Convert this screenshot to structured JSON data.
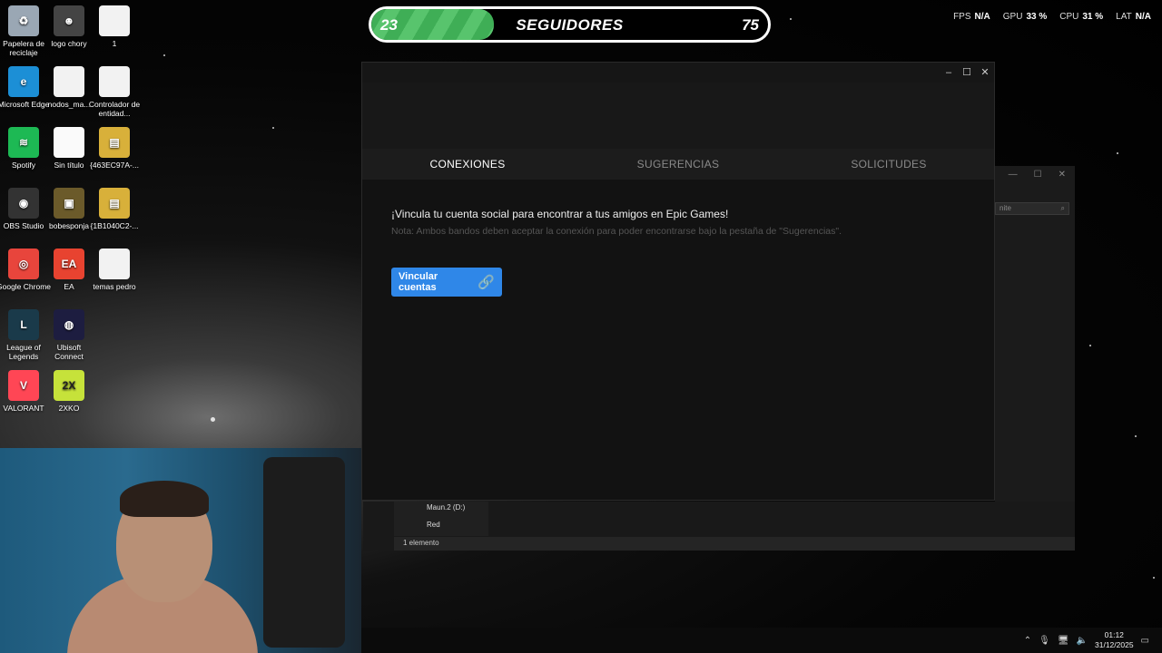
{
  "overlay": {
    "followers_current": "23",
    "followers_title": "SEGUIDORES",
    "followers_goal": "75",
    "followers_progress": 0.31,
    "stats": [
      {
        "label": "FPS",
        "value": "N/A"
      },
      {
        "label": "GPU",
        "value": "33 %"
      },
      {
        "label": "CPU",
        "value": "31 %"
      },
      {
        "label": "LAT",
        "value": "N/A"
      }
    ]
  },
  "desktop_icons": [
    {
      "label": "Papelera de reciclaje",
      "icon": "recycle-bin-icon",
      "color": "#9aa7b4",
      "glyph": "♻"
    },
    {
      "label": "logo chory",
      "icon": "image-file-icon",
      "color": "#444",
      "glyph": "☻"
    },
    {
      "label": "1",
      "icon": "file-icon",
      "color": "#f2f2f2",
      "glyph": ""
    },
    {
      "label": "Microsoft Edge",
      "icon": "edge-icon",
      "color": "#1c8fd6",
      "glyph": "e"
    },
    {
      "label": "nodos_ma...",
      "icon": "file-icon",
      "color": "#f2f2f2",
      "glyph": ""
    },
    {
      "label": "Controlador de entidad...",
      "icon": "file-icon",
      "color": "#f2f2f2",
      "glyph": ""
    },
    {
      "label": "Spotify",
      "icon": "spotify-icon",
      "color": "#1db954",
      "glyph": "≋"
    },
    {
      "label": "Sin título",
      "icon": "image-file-icon",
      "color": "#fafafa",
      "glyph": ""
    },
    {
      "label": "{463EC97A-...",
      "icon": "archive-icon",
      "color": "#d8b03a",
      "glyph": "▤"
    },
    {
      "label": "OBS Studio",
      "icon": "obs-icon",
      "color": "#333",
      "glyph": "◉"
    },
    {
      "label": "bobesponja",
      "icon": "image-file-icon",
      "color": "#6b5a2a",
      "glyph": "▣"
    },
    {
      "label": "{1B1040C2-...",
      "icon": "archive-icon",
      "color": "#d8b03a",
      "glyph": "▤"
    },
    {
      "label": "Google Chrome",
      "icon": "chrome-icon",
      "color": "#e8453c",
      "glyph": "◎"
    },
    {
      "label": "EA",
      "icon": "ea-icon",
      "color": "#e84330",
      "glyph": "EA"
    },
    {
      "label": "temas pedro",
      "icon": "file-icon",
      "color": "#f2f2f2",
      "glyph": ""
    },
    {
      "label": "League of Legends",
      "icon": "lol-icon",
      "color": "#1a3a4a",
      "glyph": "L"
    },
    {
      "label": "Ubisoft Connect",
      "icon": "ubisoft-icon",
      "color": "#1d1d40",
      "glyph": "◍"
    },
    {
      "label": "",
      "icon": "blank",
      "color": "transparent",
      "glyph": ""
    },
    {
      "label": "VALORANT",
      "icon": "valorant-icon",
      "color": "#ff4655",
      "glyph": "V"
    },
    {
      "label": "2XKO",
      "icon": "2xko-icon",
      "color": "#c6e23a",
      "glyph": "2X"
    }
  ],
  "epic": {
    "tabs": [
      {
        "label": "CONEXIONES",
        "active": true
      },
      {
        "label": "SUGERENCIAS",
        "active": false
      },
      {
        "label": "SOLICITUDES",
        "active": false
      }
    ],
    "message": "¡Vincula tu cuenta social para encontrar a tus amigos en Epic Games!",
    "note": "Nota: Ambos bandos deben aceptar la conexión para poder encontrarse bajo la pestaña de \"Sugerencias\".",
    "link_button": "Vincular cuentas"
  },
  "explorer": {
    "search_placeholder": "nite",
    "nav_items": [
      "Maun.2 (D:)",
      "Red"
    ],
    "status": "1 elemento"
  },
  "taskbar": {
    "time": "01:12",
    "date": "31/12/2025"
  }
}
